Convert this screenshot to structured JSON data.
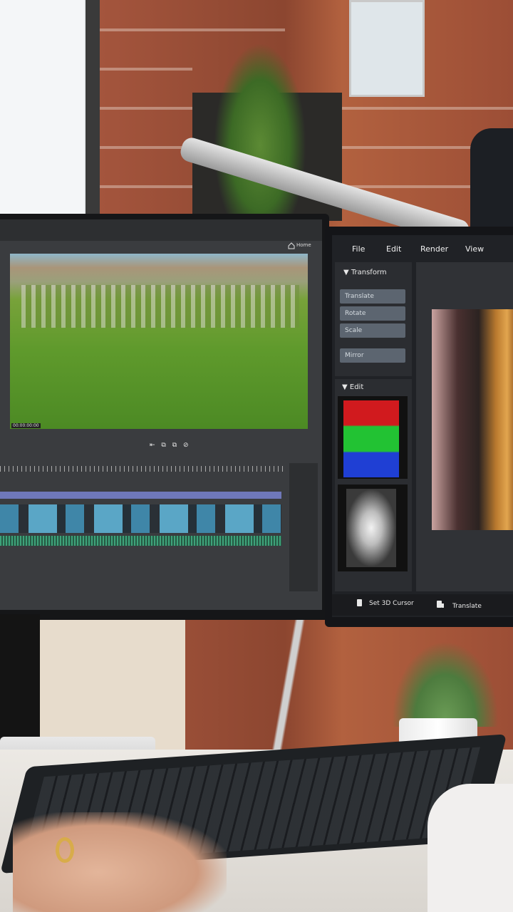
{
  "left_app": {
    "menubar": {
      "home_label": "Home"
    },
    "preview": {
      "timecode": "00:00:00:00"
    },
    "controls_glyphs": "⇤ ⧉ ⧉ ⊘",
    "icons": {
      "home": "home-icon"
    }
  },
  "right_app": {
    "menu": [
      "File",
      "Edit",
      "Render",
      "View"
    ],
    "transform_panel": {
      "title": "▼ Transform",
      "buttons": [
        "Translate",
        "Rotate",
        "Scale",
        "Mirror"
      ]
    },
    "edit_panel": {
      "title": "▼ Edit"
    },
    "bottom_bar": {
      "cursor_label": "Set 3D Cursor",
      "translate_label": "Translate"
    }
  },
  "colors": {
    "rgb_red": "#d11a1e",
    "rgb_green": "#22c233",
    "rgb_blue": "#1f3fd4",
    "timeline_blue": "#3f86a8",
    "audio_green": "#3ea27a"
  }
}
